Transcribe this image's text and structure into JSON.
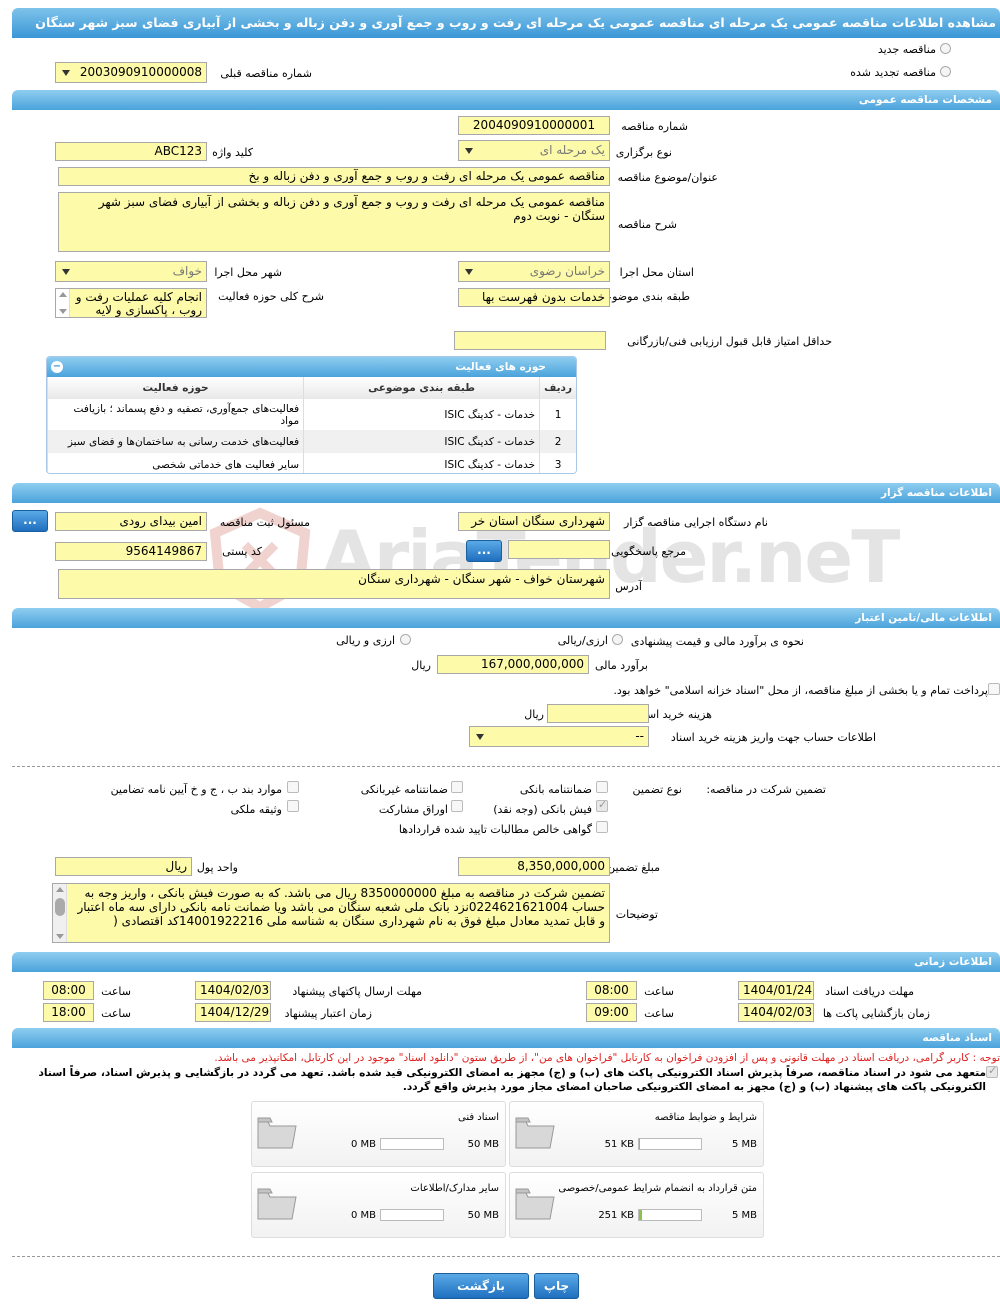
{
  "title": "مشاهده اطلاعات مناقصه عمومی یک مرحله ای مناقصه عمومی یک مرحله ای رفت و روب و جمع آوری و دفن زباله و بخشی از آبیاری فضای سبز شهر سنگان",
  "top": {
    "new_label": "مناقصه جدید",
    "renewed_label": "مناقصه تجدید شده",
    "prev_number_label": "شماره مناقصه قبلی",
    "prev_number": "2003090910000008"
  },
  "general": {
    "header": "مشخصات مناقصه عمومی",
    "number_label": "شماره مناقصه",
    "number": "2004090910000001",
    "type_label": "نوع برگزاری",
    "type": "یک مرحله ای",
    "keyword_label": "کلید واژه",
    "keyword": "ABC123",
    "subject_label": "عنوان/موضوع مناقصه",
    "subject": "مناقصه عمومی یک مرحله ای رفت و روب و جمع آوری و دفن زباله  و بخ",
    "desc_label": "شرح مناقصه",
    "desc": "مناقصه عمومی یک مرحله ای رفت و روب و جمع آوری و دفن زباله  و بخشی از آبیاری فضای سبز شهر سنگان - نوبت دوم",
    "province_label": "استان محل اجرا",
    "province": "خراسان رضوی",
    "city_label": "شهر محل اجرا",
    "city": "خواف",
    "category_label": "طبقه بندی موضوعی",
    "category": "خدمات بدون فهرست بها",
    "scope_label": "شرح کلی حوزه فعالیت",
    "scope": "انجام کلیه عملیات رفت و روب ، پاکسازی و لایه روبی",
    "min_score_label": "حداقل امتیاز قابل قبول ارزیابی فنی/بازرگانی",
    "min_score": ""
  },
  "activities": {
    "header": "حوزه های فعالیت",
    "cols": [
      "ردیف",
      "طبقه بندی موضوعی",
      "حوزه فعالیت"
    ],
    "rows": [
      {
        "n": "1",
        "cat": "خدمات - کدینگ ISIC",
        "area": "فعالیت‌های جمع‌آوری، تصفیه و دفع پسماند ؛ بازیافت مواد"
      },
      {
        "n": "2",
        "cat": "خدمات - کدینگ ISIC",
        "area": "فعالیت‌های خدمت رسانی به ساختمان‌ها و فضای سبز"
      },
      {
        "n": "3",
        "cat": "خدمات - کدینگ ISIC",
        "area": "سایر فعالیت های خدماتی شخصی"
      }
    ]
  },
  "organizer": {
    "header": "اطلاعات مناقصه گزار",
    "org_label": "نام دستگاه اجرایی مناقصه گزار",
    "org": "شهرداری سنگان استان خر",
    "reg_label": "مسئول ثبت مناقصه",
    "reg": "امین بیدای رودی",
    "ref_label": "مرجع پاسخگویی",
    "ref": "",
    "postal_label": "کد پستی",
    "postal": "9564149867",
    "address_label": "آدرس",
    "address": "شهرستان خواف - شهر سنگان - شهرداری سنگان",
    "dots": "..."
  },
  "finance": {
    "header": "اطلاعات مالی/تامین اعتبار",
    "method_label": "نحوه ی برآورد مالی و قیمت پیشنهادی",
    "opt1": "ارزی/ریالی",
    "opt2": "ارزی و ریالی",
    "estimate_label": "برآورد مالی",
    "estimate": "167,000,000,000",
    "rial": "ریال",
    "treasury_text": "پرداخت تمام و یا بخشی از مبلغ مناقصه، از محل \"اسناد خزانه اسلامی\" خواهد بود.",
    "doc_fee_label": "هزینه خرید اسناد",
    "doc_fee": "",
    "account_label": "اطلاعات حساب جهت واریز هزینه خرید اسناد",
    "account": "--"
  },
  "guarantee": {
    "part_label": "تضمین شرکت در مناقصه:",
    "type_label": "نوع تضمین",
    "items": [
      "ضمانتنامه بانکی",
      "ضمانتنامه غیربانکی",
      "موارد بند ب ، ج و خ آیین نامه تضامین",
      "فیش بانکی (وجه نقد)",
      "اوراق مشارکت",
      "وثیقه ملکی",
      "گواهی خالص مطالبات تایید شده قراردادها"
    ],
    "amount_label": "مبلغ تضمین",
    "amount": "8,350,000,000",
    "currency_label": "واحد پول",
    "currency": "ریال",
    "notes_label": "توضیحات",
    "notes": "تضمین شرکت در مناقصه به مبلغ  8350000000 ریال می باشد. که به صورت فیش بانکی ، واریز وجه به حساب  0224621621004نزد بانک ملی شعبه سنگان می باشد ویا ضمانت نامه بانکی دارای سه ماه اعتبار و قابل تمدید معادل مبلغ فوق به نام شهرداری سنگان به شناسه ملی  14001922216کد اقتصادی  ("
  },
  "timing": {
    "header": "اطلاعات زمانی",
    "receive_label": "مهلت دریافت اسناد",
    "receive_date": "1404/01/24",
    "receive_time": "08:00",
    "send_label": "مهلت ارسال پاکتهای پیشنهاد",
    "send_date": "1404/02/03",
    "send_time": "08:00",
    "open_label": "زمان بازگشایی پاکت ها",
    "open_date": "1404/02/03",
    "open_time": "09:00",
    "valid_label": "زمان اعتبار پیشنهاد",
    "valid_date": "1404/12/29",
    "valid_time": "18:00",
    "time_label": "ساعت"
  },
  "docs": {
    "header": "اسناد مناقصه",
    "note": "توجه : کاربر گرامی، دریافت اسناد در مهلت قانونی و پس از افزودن فراخوان به کارتابل \"فراخوان های من\"، از طریق ستون \"دانلود اسناد\" موجود در این کارتابل، امکانپذیر می باشد.",
    "commit": "متعهد می شود در اسناد مناقصه، صرفاً پذیرش اسناد الکترونیکی پاکت های (ب) و (ج) مجهز به امضای الکترونیکی قید شده باشد. تعهد می گردد در بازگشایی و پذیرش اسناد، صرفاً اسناد الکترونیکی پاکت های پیشنهاد (ب) و (ج) مجهز به امضای الکترونیکی صاحبان امضای مجاز مورد پذیرش واقع گردد.",
    "files": [
      {
        "name": "شرایط و ضوابط مناقصه",
        "cur": "51 KB",
        "max": "5 MB",
        "fill": 0.01
      },
      {
        "name": "اسناد فنی",
        "cur": "0 MB",
        "max": "50 MB",
        "fill": 0
      },
      {
        "name": "متن قرارداد به انضمام شرایط عمومی/خصوصی",
        "cur": "251 KB",
        "max": "5 MB",
        "fill": 0.05
      },
      {
        "name": "سایر مدارک/اطلاعات",
        "cur": "0 MB",
        "max": "50 MB",
        "fill": 0
      }
    ]
  },
  "buttons": {
    "print": "چاپ",
    "back": "بازگشت"
  },
  "watermark": "AriaTender.neT"
}
